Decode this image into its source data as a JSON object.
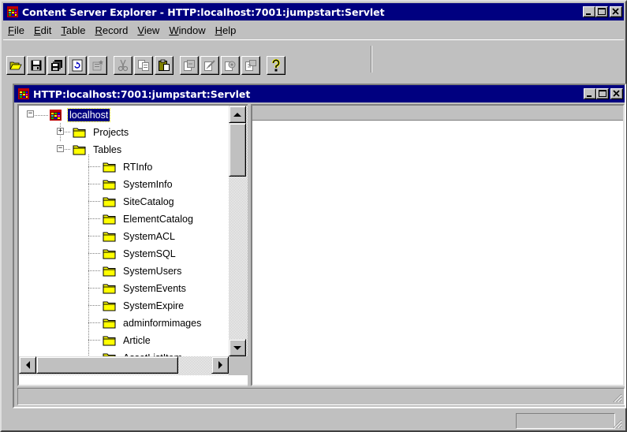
{
  "app": {
    "title": "Content Server Explorer - HTTP:localhost:7001:jumpstart:Servlet",
    "icon": "database-grid-icon"
  },
  "menu": [
    {
      "label": "File",
      "mnemonic": "F",
      "rest": "ile"
    },
    {
      "label": "Edit",
      "mnemonic": "E",
      "rest": "dit"
    },
    {
      "label": "Table",
      "mnemonic": "T",
      "rest": "able"
    },
    {
      "label": "Record",
      "mnemonic": "R",
      "rest": "ecord"
    },
    {
      "label": "View",
      "mnemonic": "V",
      "rest": "iew"
    },
    {
      "label": "Window",
      "mnemonic": "W",
      "rest": "indow"
    },
    {
      "label": "Help",
      "mnemonic": "H",
      "rest": "elp"
    }
  ],
  "toolbar": {
    "buttons": [
      {
        "icon": "open-folder-icon",
        "enabled": true
      },
      {
        "icon": "save-icon",
        "enabled": true
      },
      {
        "icon": "save-all-icon",
        "enabled": true
      },
      {
        "icon": "refresh-icon",
        "enabled": true
      },
      {
        "icon": "new-record-icon",
        "enabled": false
      },
      {
        "icon": "cut-icon",
        "enabled": false
      },
      {
        "icon": "copy-icon",
        "enabled": false
      },
      {
        "icon": "paste-icon",
        "enabled": true
      },
      {
        "icon": "doc-action-1-icon",
        "enabled": false
      },
      {
        "icon": "doc-action-2-icon",
        "enabled": false
      },
      {
        "icon": "doc-action-3-icon",
        "enabled": false
      },
      {
        "icon": "doc-action-4-icon",
        "enabled": false
      },
      {
        "icon": "help-icon",
        "enabled": true
      }
    ]
  },
  "child_window": {
    "title": "HTTP:localhost:7001:jumpstart:Servlet"
  },
  "tree": {
    "root": {
      "label": "localhost",
      "selected": true,
      "expanded": true
    },
    "projects": {
      "label": "Projects",
      "expanded": false
    },
    "tables": {
      "label": "Tables",
      "expanded": true,
      "children": [
        "RTInfo",
        "SystemInfo",
        "SiteCatalog",
        "ElementCatalog",
        "SystemACL",
        "SystemSQL",
        "SystemUsers",
        "SystemEvents",
        "SystemExpire",
        "adminformimages",
        "Article",
        "AssetListItem"
      ]
    }
  },
  "colors": {
    "titlebar": "#000080",
    "face": "#c0c0c0",
    "folder": "#ffff00",
    "selection": "#000080"
  }
}
